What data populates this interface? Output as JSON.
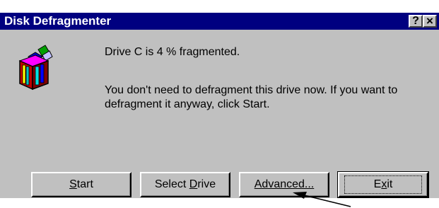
{
  "window": {
    "title": "Disk Defragmenter",
    "help_button": "?",
    "close_button": "×"
  },
  "icon": "defragmenter-books-icon",
  "message": {
    "status": "Drive C is 4 % fragmented.",
    "advice": "You don't need to defragment this drive now. If you want to defragment it anyway, click Start."
  },
  "buttons": {
    "start": {
      "mnemonic": "S",
      "rest": "tart"
    },
    "select_drive": {
      "pre": "Select ",
      "mnemonic": "D",
      "rest": "rive"
    },
    "advanced": {
      "pre": "",
      "mnemonic": "Advanced...",
      "rest": ""
    },
    "exit": {
      "pre": "E",
      "mnemonic": "x",
      "rest": "it"
    }
  },
  "colors": {
    "title_bar": "#000080",
    "dialog_face": "#c0c0c0"
  }
}
